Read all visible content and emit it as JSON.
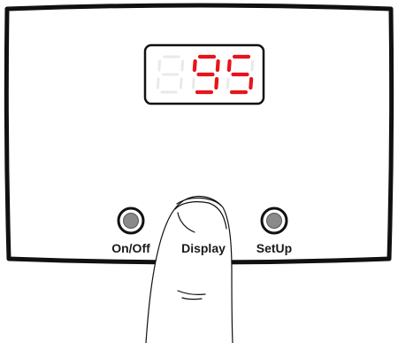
{
  "display": {
    "value": "95",
    "digit_count": 3,
    "lit_color": "#e8141c",
    "unlit_color": "#e9e9e9"
  },
  "buttons": [
    {
      "label": "On/Off"
    },
    {
      "label": "Display"
    },
    {
      "label": "SetUp"
    }
  ],
  "colors": {
    "panel_border": "#111111",
    "button_face": "#8a8a8a"
  }
}
